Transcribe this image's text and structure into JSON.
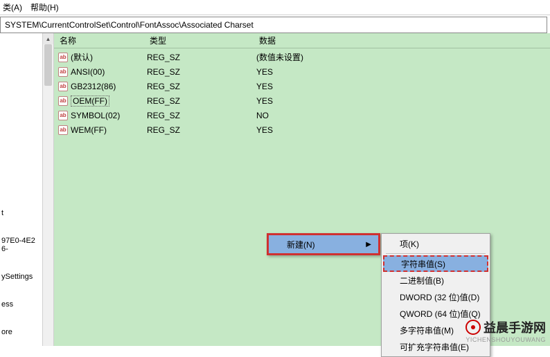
{
  "menubar": {
    "item1": "类(A)",
    "item2": "帮助(H)"
  },
  "address": "SYSTEM\\CurrentControlSet\\Control\\FontAssoc\\Associated Charset",
  "columns": {
    "name": "名称",
    "type": "类型",
    "data": "数据"
  },
  "rows": [
    {
      "name": "(默认)",
      "type": "REG_SZ",
      "data": "(数值未设置)"
    },
    {
      "name": "ANSI(00)",
      "type": "REG_SZ",
      "data": "YES"
    },
    {
      "name": "GB2312(86)",
      "type": "REG_SZ",
      "data": "YES"
    },
    {
      "name": "OEM(FF)",
      "type": "REG_SZ",
      "data": "YES",
      "selected": true
    },
    {
      "name": "SYMBOL(02)",
      "type": "REG_SZ",
      "data": "NO"
    },
    {
      "name": "WEM(FF)",
      "type": "REG_SZ",
      "data": "YES"
    }
  ],
  "leftitems": {
    "a": "t",
    "b": "97E0-4E26-",
    "c": "ySettings",
    "d": "ess",
    "e": "ore"
  },
  "context1": {
    "new": "新建(N)"
  },
  "context2": {
    "key": "项(K)",
    "string": "字符串值(S)",
    "binary": "二进制值(B)",
    "dword": "DWORD (32 位)值(D)",
    "qword": "QWORD (64 位)值(Q)",
    "multi": "多字符串值(M)",
    "expand": "可扩充字符串值(E)"
  },
  "watermark": {
    "brand": "益晨手游网",
    "url": "YICHENSHOUYOUWANG"
  }
}
